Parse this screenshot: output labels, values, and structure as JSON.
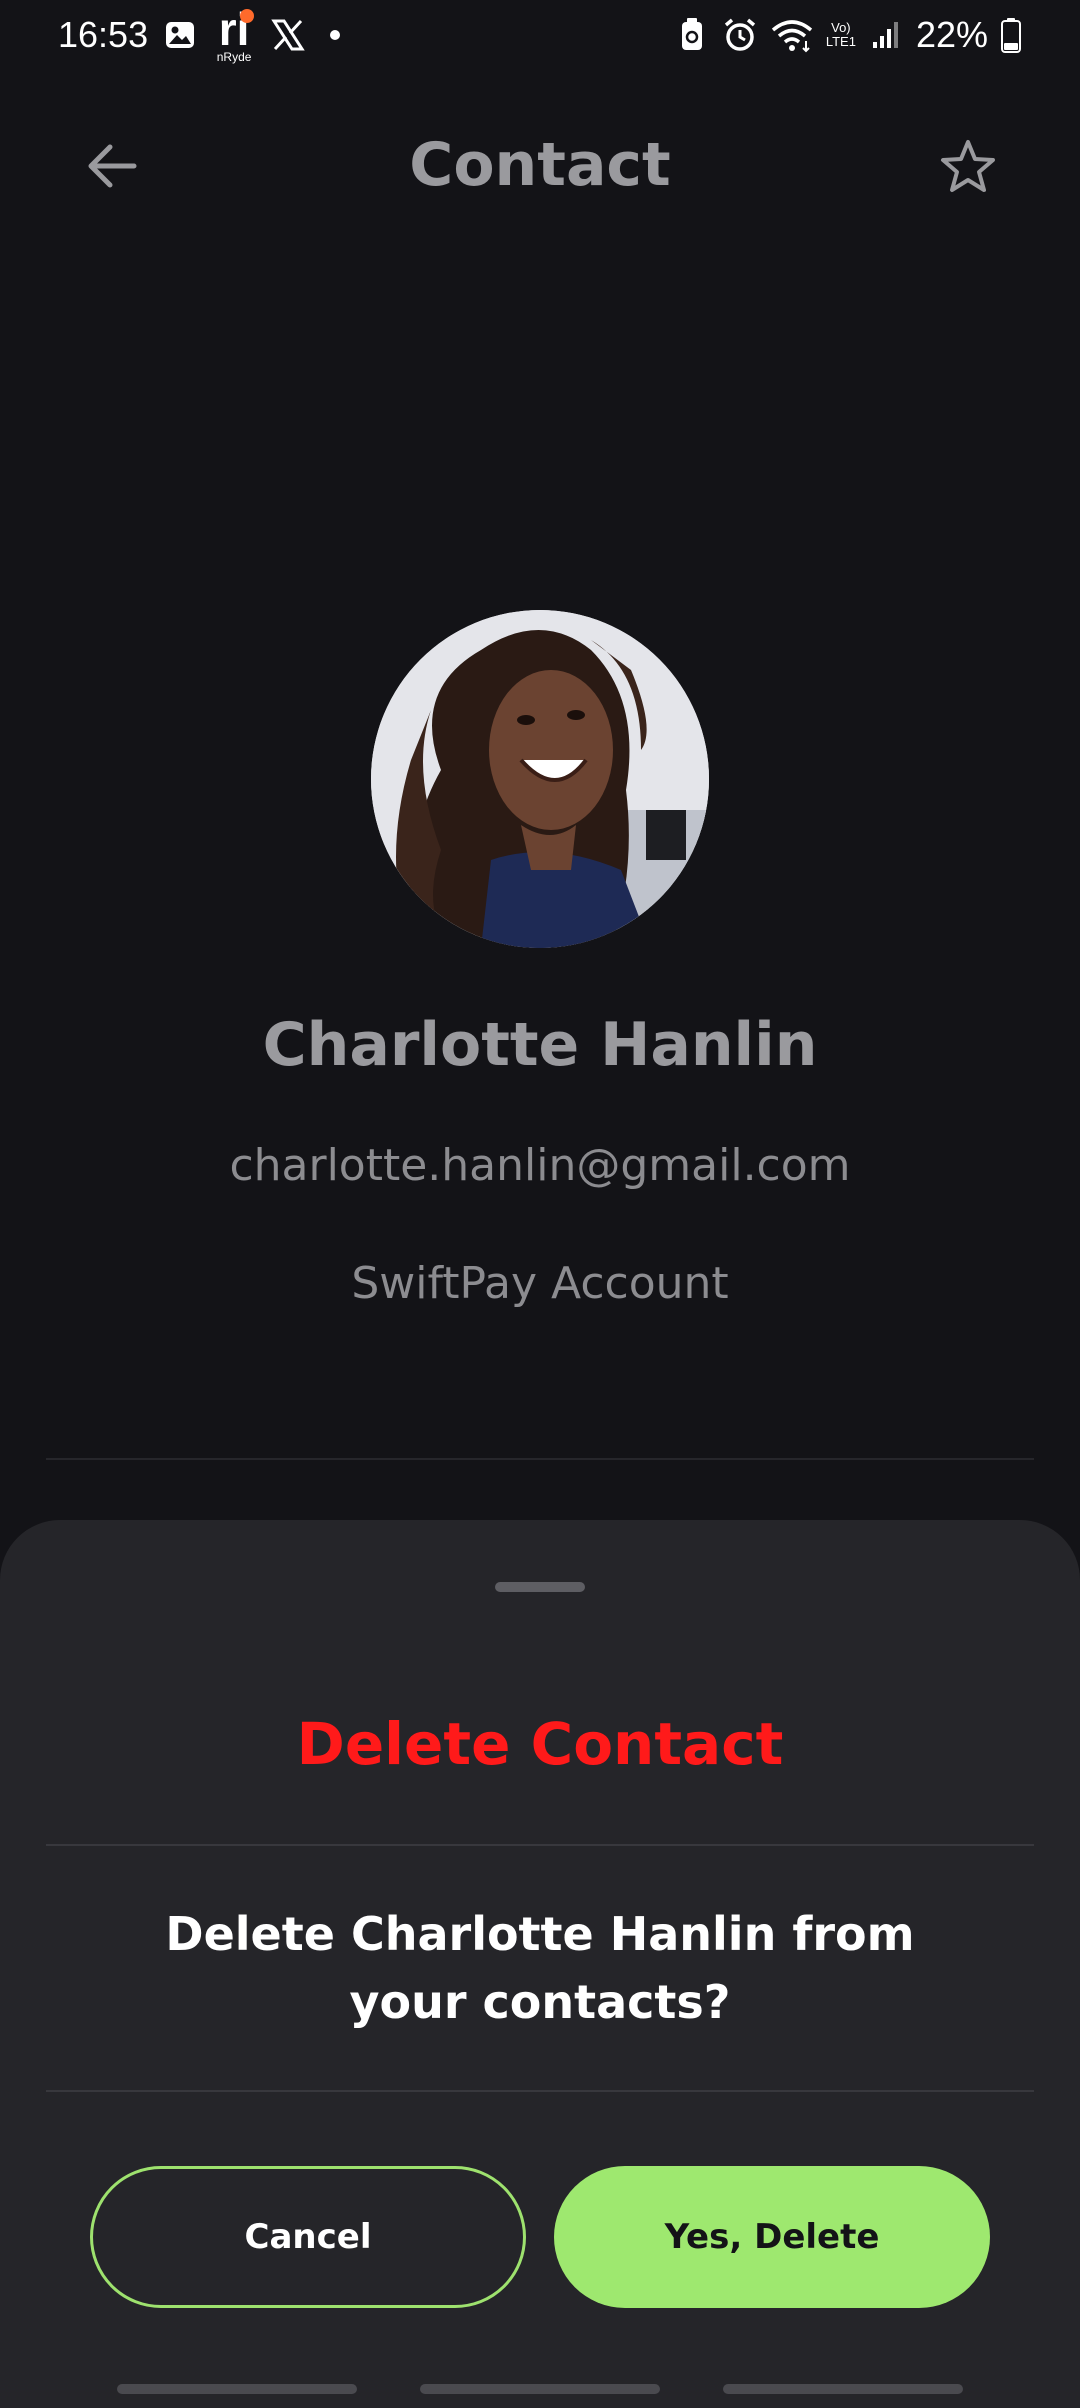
{
  "status_bar": {
    "time": "16:53",
    "nryde_label": "nRyde",
    "nryde_mark": "ri",
    "volte_line1": "Vo)",
    "volte_line2": "LTE1",
    "battery": "22%",
    "icons": [
      "gallery-icon",
      "nryde-app-icon",
      "x-app-icon",
      "notification-dot",
      "battery-saver-icon",
      "alarm-icon",
      "wifi-icon",
      "volte-icon",
      "signal-icon",
      "battery-icon"
    ]
  },
  "header": {
    "title": "Contact",
    "back_icon": "arrow-left-icon",
    "favorite_icon": "star-outline-icon"
  },
  "contact": {
    "name": "Charlotte Hanlin",
    "email": "charlotte.hanlin@gmail.com",
    "account": "SwiftPay Account"
  },
  "dialog": {
    "title": "Delete Contact",
    "message": "Delete Charlotte Hanlin from your contacts?",
    "cancel_label": "Cancel",
    "confirm_label": "Yes, Delete"
  },
  "colors": {
    "background": "#131317",
    "sheet": "#252529",
    "accent_green": "#9ee86f",
    "danger_red": "#ff1a1a",
    "muted_text": "#9a9a9e"
  }
}
